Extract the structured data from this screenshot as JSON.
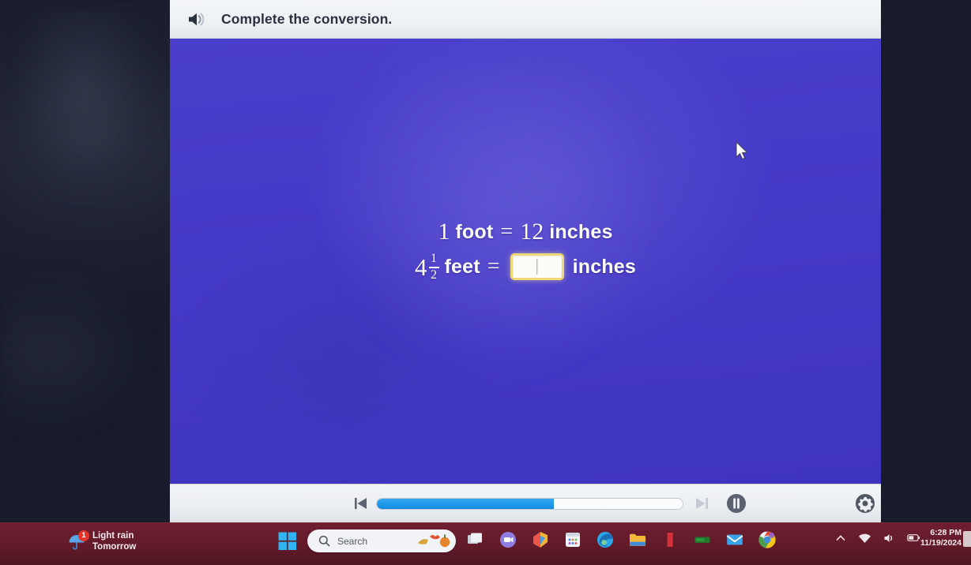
{
  "app": {
    "header": {
      "speaker_icon": "speaker-audio-icon",
      "prompt": "Complete the conversion."
    },
    "question": {
      "reference_line": {
        "quantity": "1",
        "unit_from": "foot",
        "equals": "=",
        "value": "12",
        "unit_to": "inches"
      },
      "answer_line": {
        "whole": "4",
        "numerator": "1",
        "denominator": "2",
        "unit_from": "feet",
        "equals": "=",
        "input_value": "",
        "unit_to": "inches"
      }
    },
    "player": {
      "prev_icon": "skip-previous-icon",
      "next_icon": "skip-next-icon",
      "pause_icon": "pause-icon",
      "settings_icon": "gear-icon",
      "progress_percent": 58
    },
    "colors": {
      "stage_background": "#4439c6",
      "accent_progress": "#1f97e8",
      "answer_border": "#f0d878",
      "taskbar": "#621a29"
    }
  },
  "taskbar": {
    "weather": {
      "icon": "umbrella-rain-icon",
      "badge": "1",
      "condition": "Light rain",
      "when": "Tomorrow"
    },
    "start_icon": "windows-logo-icon",
    "search": {
      "icon": "search-icon",
      "placeholder": "Search",
      "decoration_icon": "autumn-pumpkin-icon"
    },
    "apps": [
      {
        "name": "task-view-icon",
        "label": "Task View"
      },
      {
        "name": "chat-teams-icon",
        "label": "Chat"
      },
      {
        "name": "office-icon",
        "label": "Microsoft 365"
      },
      {
        "name": "microsoft-store-icon",
        "label": "Microsoft Store"
      },
      {
        "name": "edge-browser-icon",
        "label": "Microsoft Edge"
      },
      {
        "name": "file-explorer-icon",
        "label": "File Explorer"
      },
      {
        "name": "red-app-icon",
        "label": "App"
      },
      {
        "name": "green-app-icon",
        "label": "App"
      },
      {
        "name": "mail-icon",
        "label": "Mail"
      },
      {
        "name": "chrome-browser-icon",
        "label": "Google Chrome"
      }
    ],
    "tray": [
      {
        "name": "show-hidden-icons-chevron-icon",
        "label": "Show hidden icons"
      },
      {
        "name": "wifi-icon",
        "label": "Network"
      },
      {
        "name": "volume-icon",
        "label": "Volume"
      },
      {
        "name": "battery-icon",
        "label": "Battery"
      }
    ],
    "clock": {
      "time": "6:28 PM",
      "date": "11/19/2024"
    }
  }
}
